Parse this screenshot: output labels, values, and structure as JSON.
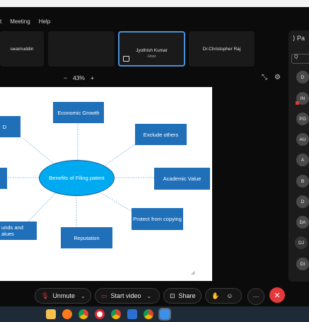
{
  "menu": {
    "items": [
      "t",
      "Meeting",
      "Help"
    ]
  },
  "tiles": [
    {
      "name": "swamuddin",
      "sub": ""
    },
    {
      "name": "",
      "sub": ""
    },
    {
      "name": "Jyothish Kumar",
      "sub": "Host"
    },
    {
      "name": "Dr.Christopher Raj",
      "sub": ""
    }
  ],
  "zoom": {
    "minus": "−",
    "value": "43%",
    "plus": "+"
  },
  "slide": {
    "center": "Benefits of Filing patent",
    "nodes": {
      "economic": "Economic Growth",
      "exclude": "Exclude others",
      "academic": "Academic Value",
      "protect": "Protect from copying",
      "reputation": "Reputation",
      "rewards": "unds and\nalues",
      "left_top": "D"
    }
  },
  "panel": {
    "header": "Pa",
    "search": "Q",
    "avatars": [
      "D",
      "IN",
      "PO",
      "AU",
      "A",
      "B",
      "D",
      "DA",
      "DJ",
      "DI"
    ]
  },
  "toolbar": {
    "unmute": "Unmute",
    "start_video": "Start video",
    "share": "Share",
    "more": "···",
    "leave": "✕"
  },
  "colors": {
    "box": "#1f6fb9",
    "ellipse": "#00aaf0",
    "active_tile": "#4a90d9",
    "leave": "#e5383b"
  }
}
